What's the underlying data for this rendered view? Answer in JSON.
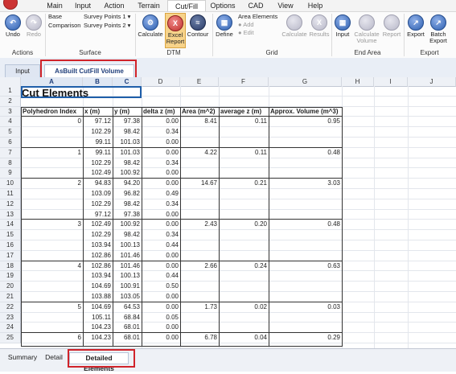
{
  "menu": {
    "tabs": [
      "Main",
      "Input",
      "Action",
      "Terrain",
      "Cut/Fill",
      "Options",
      "CAD",
      "View",
      "Help"
    ],
    "active_tab": "Cut/Fill"
  },
  "ribbon": {
    "actions": {
      "label": "Actions",
      "undo": "Undo",
      "redo": "Redo"
    },
    "surface": {
      "label": "Surface",
      "base_label": "Base",
      "base_value": "Survey Points 1",
      "comparison_label": "Comparison",
      "comparison_value": "Survey Points 2"
    },
    "dtm": {
      "label": "DTM",
      "calculate": "Calculate",
      "excel_report_1": "Excel",
      "excel_report_2": "Report",
      "contour": "Contour"
    },
    "grid": {
      "label": "Grid",
      "define": "Define",
      "area_elements": "Area Elements",
      "add": "Add",
      "edit": "Edit",
      "calculate": "Calculate",
      "results": "Results"
    },
    "end_area": {
      "label": "End Area",
      "input": "Input",
      "calculate_1": "Calculate",
      "calculate_2": "Volume",
      "report": "Report"
    },
    "export": {
      "label": "Export",
      "export": "Export",
      "batch_1": "Batch",
      "batch_2": "Export"
    }
  },
  "doc_tabs": [
    "Input",
    "AsBuilt CutFill Volume"
  ],
  "sheet": {
    "columns": [
      "A",
      "B",
      "C",
      "D",
      "E",
      "F",
      "G",
      "H",
      "I",
      "J"
    ],
    "title": "Cut Elements",
    "headers": [
      "Polyhedron Index",
      "x (m)",
      "y (m)",
      "delta z (m)",
      "Area (m^2)",
      "average z (m)",
      "Approx. Volume (m^3)"
    ],
    "rows": [
      [
        "0",
        "97.12",
        "97.38",
        "0.00",
        "8.41",
        "0.11",
        "0.95"
      ],
      [
        "",
        "102.29",
        "98.42",
        "0.34",
        "",
        "",
        ""
      ],
      [
        "",
        "99.11",
        "101.03",
        "0.00",
        "",
        "",
        ""
      ],
      [
        "1",
        "99.11",
        "101.03",
        "0.00",
        "4.22",
        "0.11",
        "0.48"
      ],
      [
        "",
        "102.29",
        "98.42",
        "0.34",
        "",
        "",
        ""
      ],
      [
        "",
        "102.49",
        "100.92",
        "0.00",
        "",
        "",
        ""
      ],
      [
        "2",
        "94.83",
        "94.20",
        "0.00",
        "14.67",
        "0.21",
        "3.03"
      ],
      [
        "",
        "103.09",
        "96.82",
        "0.49",
        "",
        "",
        ""
      ],
      [
        "",
        "102.29",
        "98.42",
        "0.34",
        "",
        "",
        ""
      ],
      [
        "",
        "97.12",
        "97.38",
        "0.00",
        "",
        "",
        ""
      ],
      [
        "3",
        "102.49",
        "100.92",
        "0.00",
        "2.43",
        "0.20",
        "0.48"
      ],
      [
        "",
        "102.29",
        "98.42",
        "0.34",
        "",
        "",
        ""
      ],
      [
        "",
        "103.94",
        "100.13",
        "0.44",
        "",
        "",
        ""
      ],
      [
        "",
        "102.86",
        "101.46",
        "0.00",
        "",
        "",
        ""
      ],
      [
        "4",
        "102.86",
        "101.46",
        "0.00",
        "2.66",
        "0.24",
        "0.63"
      ],
      [
        "",
        "103.94",
        "100.13",
        "0.44",
        "",
        "",
        ""
      ],
      [
        "",
        "104.69",
        "100.91",
        "0.50",
        "",
        "",
        ""
      ],
      [
        "",
        "103.88",
        "103.05",
        "0.00",
        "",
        "",
        ""
      ],
      [
        "5",
        "104.69",
        "64.53",
        "0.00",
        "1.73",
        "0.02",
        "0.03"
      ],
      [
        "",
        "105.11",
        "68.84",
        "0.05",
        "",
        "",
        ""
      ],
      [
        "",
        "104.23",
        "68.01",
        "0.00",
        "",
        "",
        ""
      ],
      [
        "6",
        "104.23",
        "68.01",
        "0.00",
        "6.78",
        "0.04",
        "0.29"
      ]
    ]
  },
  "sheet_tabs": [
    "Summary",
    "Detail",
    "Detailed Elements"
  ],
  "active_sheet_tab": "Detailed Elements",
  "colors": {
    "highlight": "#d0232a",
    "selected_button": "#f7d38a"
  }
}
